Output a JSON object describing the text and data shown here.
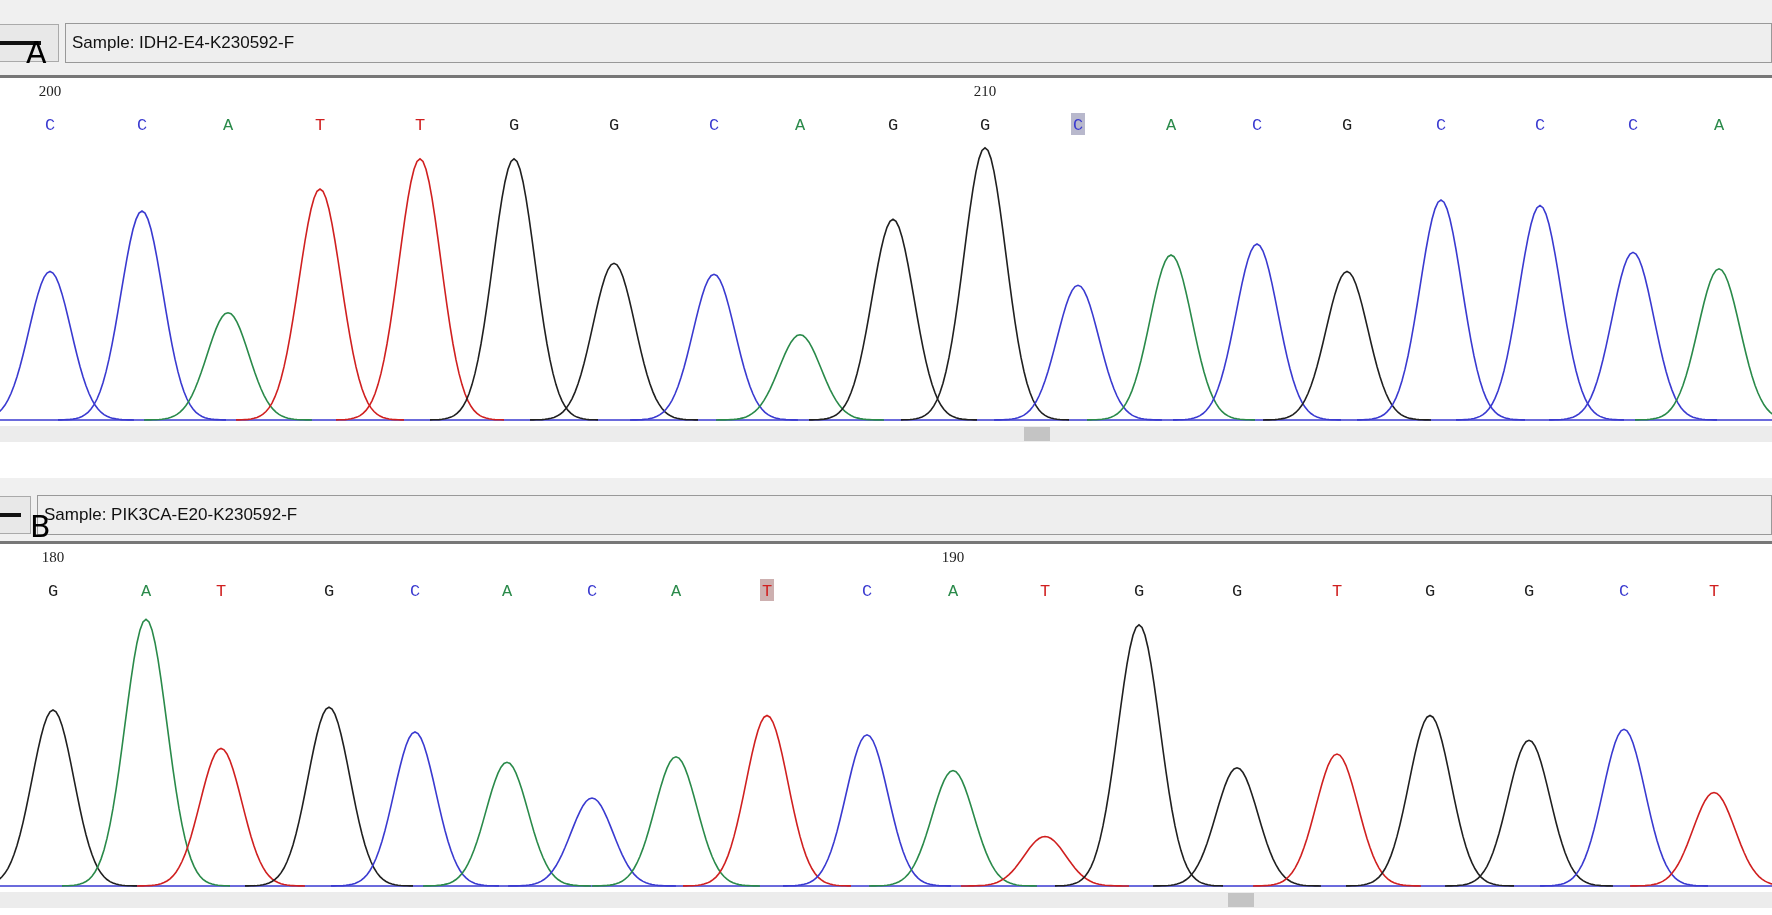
{
  "panels": [
    {
      "label": "A",
      "sample": "Sample: IDH2-E4-K230592-F",
      "bases": [
        {
          "base": "C",
          "color": "#3a3ad0",
          "selected": false,
          "tick": "200"
        },
        {
          "base": "C",
          "color": "#3a3ad0",
          "selected": false
        },
        {
          "base": "A",
          "color": "#2a8a4a",
          "selected": false
        },
        {
          "base": "T",
          "color": "#d02020",
          "selected": false
        },
        {
          "base": "T",
          "color": "#d02020",
          "selected": false
        },
        {
          "base": "G",
          "color": "#202020",
          "selected": false
        },
        {
          "base": "G",
          "color": "#202020",
          "selected": false
        },
        {
          "base": "C",
          "color": "#3a3ad0",
          "selected": false
        },
        {
          "base": "A",
          "color": "#2a8a4a",
          "selected": false
        },
        {
          "base": "G",
          "color": "#202020",
          "selected": false
        },
        {
          "base": "G",
          "color": "#202020",
          "selected": false,
          "tick": "210"
        },
        {
          "base": "C",
          "color": "#3a3ad0",
          "selected": true
        },
        {
          "base": "A",
          "color": "#2a8a4a",
          "selected": false
        },
        {
          "base": "C",
          "color": "#3a3ad0",
          "selected": false
        },
        {
          "base": "G",
          "color": "#202020",
          "selected": false
        },
        {
          "base": "C",
          "color": "#3a3ad0",
          "selected": false
        },
        {
          "base": "C",
          "color": "#3a3ad0",
          "selected": false
        },
        {
          "base": "C",
          "color": "#3a3ad0",
          "selected": false
        },
        {
          "base": "A",
          "color": "#2a8a4a",
          "selected": false
        }
      ]
    },
    {
      "label": "B",
      "sample": "Sample: PIK3CA-E20-K230592-F",
      "bases": [
        {
          "base": "G",
          "color": "#202020",
          "selected": false,
          "tick": "180"
        },
        {
          "base": "A",
          "color": "#2a8a4a",
          "selected": false
        },
        {
          "base": "T",
          "color": "#d02020",
          "selected": false
        },
        {
          "base": "G",
          "color": "#202020",
          "selected": false
        },
        {
          "base": "C",
          "color": "#3a3ad0",
          "selected": false
        },
        {
          "base": "A",
          "color": "#2a8a4a",
          "selected": false
        },
        {
          "base": "C",
          "color": "#3a3ad0",
          "selected": false
        },
        {
          "base": "A",
          "color": "#2a8a4a",
          "selected": false
        },
        {
          "base": "T",
          "color": "#d02020",
          "selected": true
        },
        {
          "base": "C",
          "color": "#3a3ad0",
          "selected": false
        },
        {
          "base": "A",
          "color": "#2a8a4a",
          "selected": false,
          "tick": "190"
        },
        {
          "base": "T",
          "color": "#d02020",
          "selected": false
        },
        {
          "base": "G",
          "color": "#202020",
          "selected": false
        },
        {
          "base": "G",
          "color": "#202020",
          "selected": false
        },
        {
          "base": "T",
          "color": "#d02020",
          "selected": false
        },
        {
          "base": "G",
          "color": "#202020",
          "selected": false
        },
        {
          "base": "G",
          "color": "#202020",
          "selected": false
        },
        {
          "base": "C",
          "color": "#3a3ad0",
          "selected": false
        },
        {
          "base": "T",
          "color": "#d02020",
          "selected": false
        }
      ]
    }
  ]
}
